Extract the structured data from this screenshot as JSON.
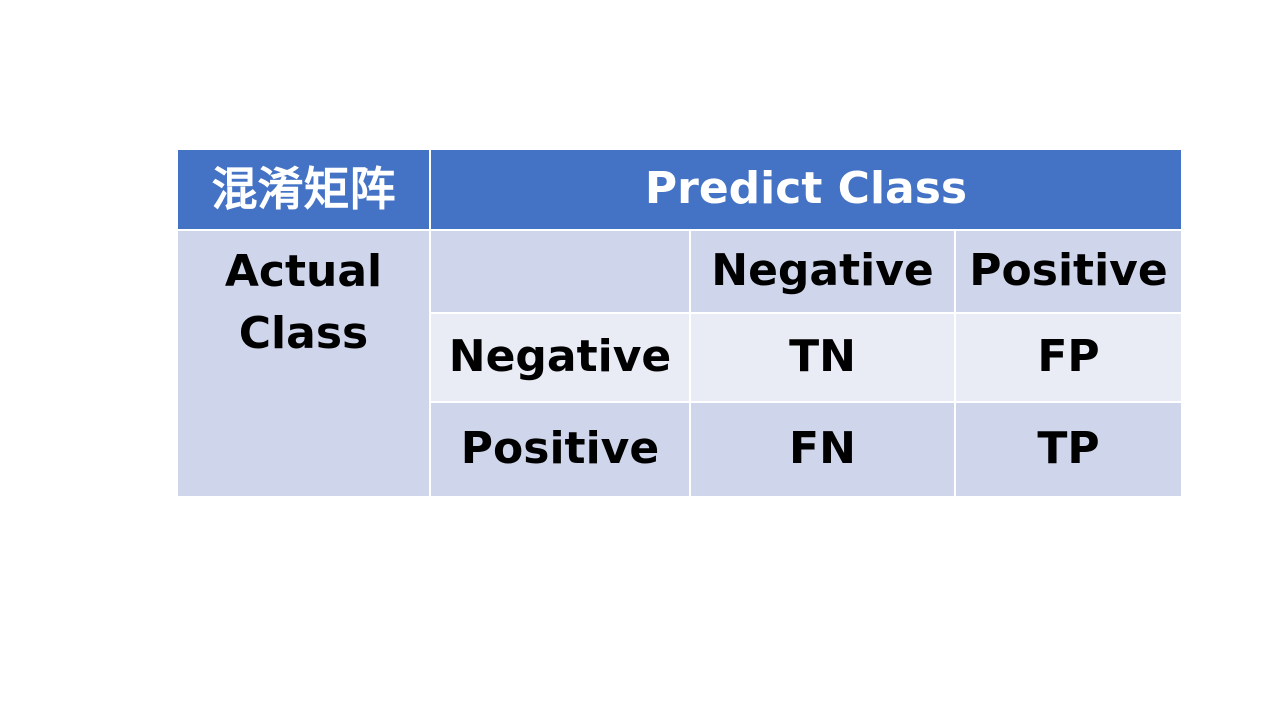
{
  "table": {
    "corner_title": "混淆矩阵",
    "predict_header": "Predict Class",
    "actual_label_line1": "Actual",
    "actual_label_line2": "Class",
    "col_headers": [
      "",
      "Negative",
      "Positive"
    ],
    "rows": [
      {
        "label": "Negative",
        "cells": [
          "TN",
          "FP"
        ]
      },
      {
        "label": "Positive",
        "cells": [
          "FN",
          "TP"
        ]
      }
    ]
  },
  "colors": {
    "header_bg": "#4472c4",
    "band_dark": "#cfd5ea",
    "band_light": "#e9ebf5"
  }
}
